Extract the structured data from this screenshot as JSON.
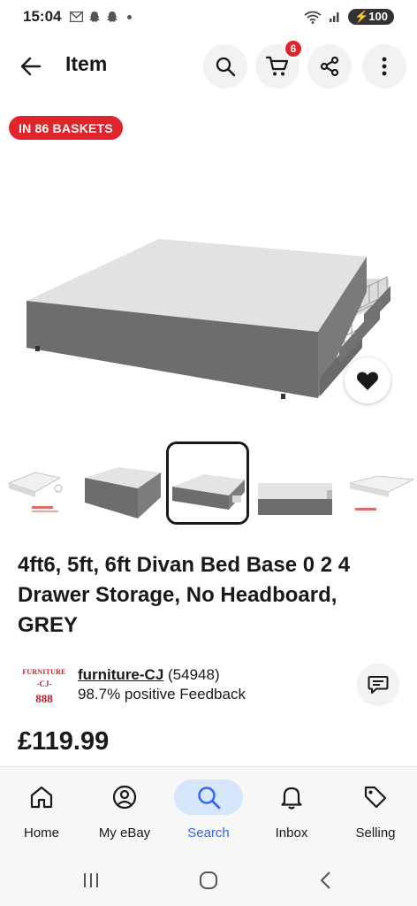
{
  "status_bar": {
    "time": "15:04",
    "battery": "100"
  },
  "header": {
    "title": "Item",
    "cart_count": "6"
  },
  "badge": {
    "baskets_text": "IN 86 BASKETS"
  },
  "thumbnails": {
    "count": 5,
    "selected_index": 2
  },
  "item": {
    "title": "4ft6, 5ft, 6ft Divan Bed Base 0 2 4 Drawer Storage, No Headboard, GREY",
    "price": "£119.99"
  },
  "seller": {
    "logo_line1": "FURNITURE",
    "logo_line2": "-CJ-",
    "logo_line3": "888",
    "name": "furniture-CJ",
    "score": "(54948)",
    "feedback": "98.7% positive Feedback"
  },
  "bottom_nav": {
    "items": [
      {
        "label": "Home",
        "icon": "home-icon"
      },
      {
        "label": "My eBay",
        "icon": "user-circle-icon"
      },
      {
        "label": "Search",
        "icon": "search-icon",
        "active": true
      },
      {
        "label": "Inbox",
        "icon": "bell-icon"
      },
      {
        "label": "Selling",
        "icon": "tag-icon"
      }
    ]
  },
  "colors": {
    "accent_blue": "#3665f3",
    "badge_red": "#e0242b",
    "active_nav_bg": "#d6e6fb"
  }
}
